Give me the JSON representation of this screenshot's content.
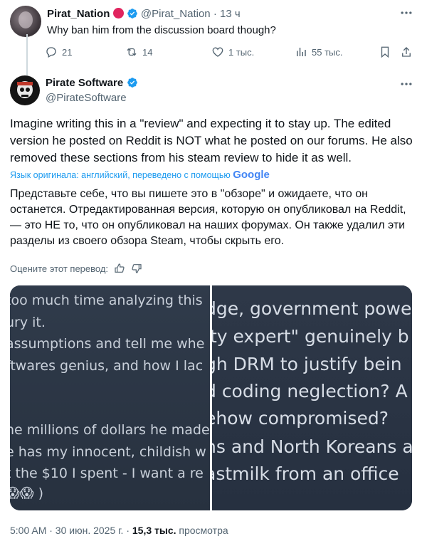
{
  "reply_tweet": {
    "display_name": "Pirat_Nation",
    "handle": "@Pirat_Nation",
    "separator": "·",
    "time_ago": "13 ч",
    "text": "Why ban him from the discussion board though?",
    "actions": {
      "replies": "21",
      "reposts": "14",
      "likes": "1 тыс.",
      "views": "55 тыс."
    }
  },
  "main_tweet": {
    "display_name": "Pirate Software",
    "handle": "@PirateSoftware",
    "text": "Imagine writing this in a \"review\" and expecting it to stay up. The edited version he posted on Reddit is NOT what he posted on our forums. He also removed these sections from his steam review to hide it as well.",
    "translation_note": "Язык оригинала: английский, переведено с помощью",
    "translation_provider": "Google",
    "translated_text": "Представьте себе, что вы пишете это в \"обзоре\" и ожидаете, что он останется. Отредактированная версия, которую он опубликовал на Reddit, — это НЕ то, что он опубликовал на наших форумах. Он также удалил эти разделы из своего обзора Steam, чтобы скрыть его.",
    "rate_translation": "Оцените этот перевод:",
    "media": {
      "left_lines": [
        "too much time analyzing this",
        "ury it.",
        "assumptions and tell me whe",
        "ftwares genius, and how I lac",
        "he millions of dollars he made",
        "e has my innocent, childish w",
        "t the $10 I spent - I want a re",
        "😱😱 )"
      ],
      "right_lines": [
        "dge, government powe",
        "ity expert\" genuinely b",
        "gh DRM to justify bein",
        "d coding neglection? A",
        "ehow compromised?",
        "ns and North Koreans a",
        "astmilk from an office"
      ]
    },
    "timestamp": "5:00 AM · 30 июн. 2025 г.",
    "views_count": "15,3 тыс.",
    "views_label": "просмотра"
  },
  "colors": {
    "accent": "#1d9bf0",
    "muted": "#536471",
    "text": "#0f1419",
    "verified": "#1d9bf0",
    "red_badge": "#e0245e"
  }
}
